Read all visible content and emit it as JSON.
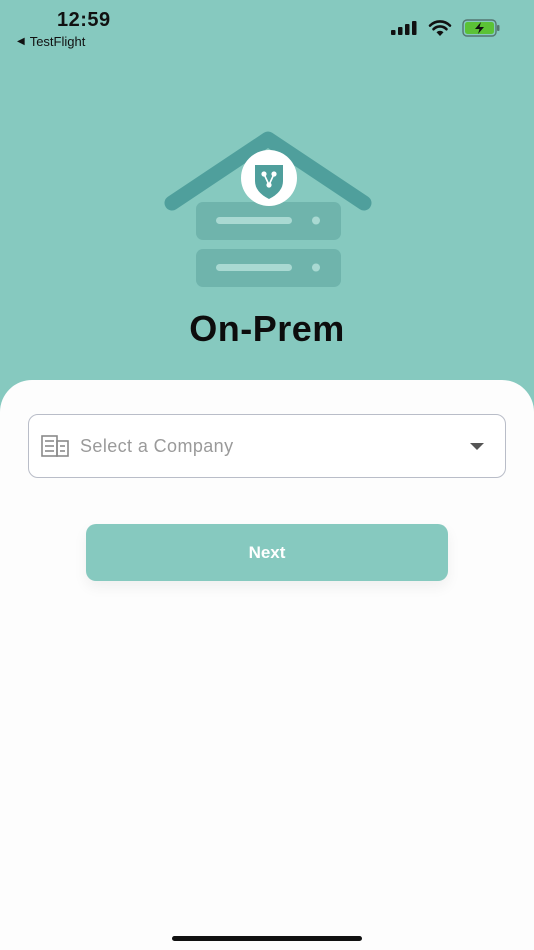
{
  "status_bar": {
    "time": "12:59",
    "back_app": "TestFlight"
  },
  "icons": {
    "back": "back-arrow-icon",
    "signal": "cellular-signal-icon",
    "wifi": "wifi-icon",
    "battery": "battery-charging-icon",
    "building": "building-icon",
    "caret": "caret-down-icon",
    "illustration": "on-prem-server-icon"
  },
  "page": {
    "title": "On-Prem"
  },
  "company_select": {
    "placeholder": "Select a Company"
  },
  "actions": {
    "next_label": "Next"
  },
  "colors": {
    "accent": "#86c9bf",
    "accent_dark": "#4f9f9c",
    "battery_green": "#5bc236"
  }
}
